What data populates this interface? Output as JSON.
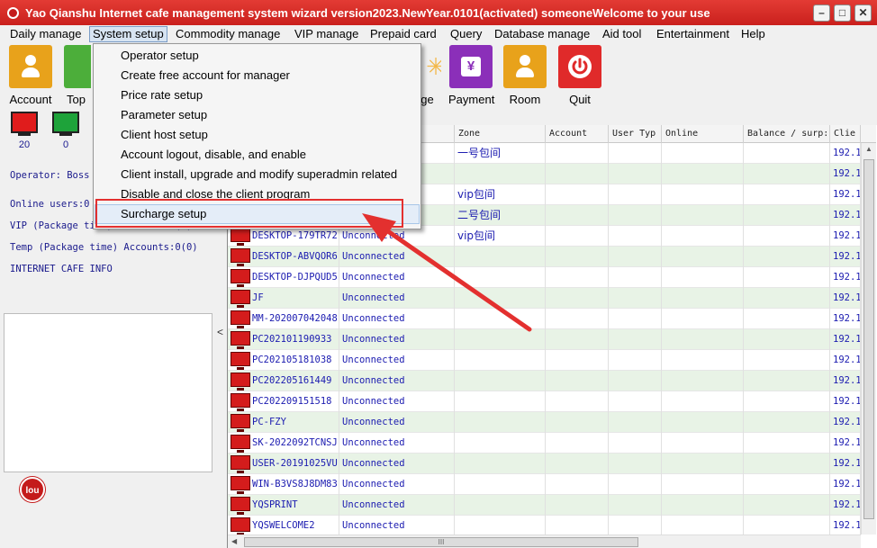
{
  "window": {
    "title": "Yao Qianshu Internet cafe management system wizard version2023.NewYear.0101(activated)   someoneWelcome to your use",
    "controls": {
      "minimize": "–",
      "maximize": "□",
      "close": "✕"
    }
  },
  "menu": [
    {
      "label": "Daily manage"
    },
    {
      "label": "System setup"
    },
    {
      "label": "Commodity manage"
    },
    {
      "label": "VIP manage"
    },
    {
      "label": "Prepaid card"
    },
    {
      "label": "Query"
    },
    {
      "label": "Database manage"
    },
    {
      "label": "Aid tool"
    },
    {
      "label": "Entertainment"
    },
    {
      "label": "Help"
    }
  ],
  "toolbar": {
    "account": {
      "label": "Account",
      "icon": "person-icon",
      "color": "#e8a21b"
    },
    "top": {
      "label": "Top",
      "icon": "topup-icon",
      "color": "#4cae3a"
    },
    "manage": {
      "label": "age",
      "icon": "manage-icon",
      "color": "#f3b84a"
    },
    "payment": {
      "label": "Payment",
      "icon": "yen-icon",
      "symbol": "¥",
      "color": "#8b2fb9"
    },
    "room": {
      "label": "Room",
      "icon": "person-icon",
      "color": "#e8a21b"
    },
    "quit": {
      "label": "Quit",
      "icon": "power-icon",
      "color": "#e02a2a"
    }
  },
  "left": {
    "stats": [
      {
        "value": "20",
        "color": "#e01c1c"
      },
      {
        "value": "0",
        "color": "#1ea33a"
      }
    ],
    "operator": "Operator: Boss",
    "online_users": "Online users:0",
    "vip": "VIP (Package time) Accounts:0(0)",
    "temp": "Temp (Package time) Accounts:0(0)",
    "info": "INTERNET CAFE  INFO",
    "logo": "lou",
    "splitter_arrow": "<"
  },
  "dropdown": {
    "items": [
      {
        "label": "Operator setup"
      },
      {
        "label": "Create free account for manager"
      },
      {
        "label": "Price rate setup"
      },
      {
        "label": "Parameter setup"
      },
      {
        "label": "Client host setup"
      },
      {
        "label": "Account logout, disable, and enable"
      },
      {
        "label": "Client install, upgrade and modify superadmin related"
      },
      {
        "label": "Disable and close the client program"
      },
      {
        "label": "Surcharge setup"
      }
    ]
  },
  "grid": {
    "headers": [
      "me)",
      "Zone",
      "Account",
      "User Typ",
      "Online",
      "Balance / surp:",
      "Clie"
    ],
    "rows": [
      {
        "name": "",
        "status": "",
        "zone": "一号包间",
        "ip": "192.1"
      },
      {
        "name": "",
        "status": "",
        "zone": "",
        "ip": "192.1"
      },
      {
        "name": "",
        "status": "",
        "zone": "vip包间",
        "ip": "192.1"
      },
      {
        "name": "",
        "status": "",
        "zone": "二号包间",
        "ip": "192.1"
      },
      {
        "name": "DESKTOP-179TR72",
        "status": "Unconnected",
        "zone": "vip包间",
        "ip": "192.1"
      },
      {
        "name": "DESKTOP-ABVQOR6",
        "status": "Unconnected",
        "zone": "",
        "ip": "192.1"
      },
      {
        "name": "DESKTOP-DJPQUD5",
        "status": "Unconnected",
        "zone": "",
        "ip": "192.1"
      },
      {
        "name": "JF",
        "status": "Unconnected",
        "zone": "",
        "ip": "192.1"
      },
      {
        "name": "MM-202007042048",
        "status": "Unconnected",
        "zone": "",
        "ip": "192.1"
      },
      {
        "name": "PC202101190933",
        "status": "Unconnected",
        "zone": "",
        "ip": "192.1"
      },
      {
        "name": "PC202105181038",
        "status": "Unconnected",
        "zone": "",
        "ip": "192.1"
      },
      {
        "name": "PC202205161449",
        "status": "Unconnected",
        "zone": "",
        "ip": "192.1"
      },
      {
        "name": "PC202209151518",
        "status": "Unconnected",
        "zone": "",
        "ip": "192.1"
      },
      {
        "name": "PC-FZY",
        "status": "Unconnected",
        "zone": "",
        "ip": "192.1"
      },
      {
        "name": "SK-2022092TCNSJ",
        "status": "Unconnected",
        "zone": "",
        "ip": "192.1"
      },
      {
        "name": "USER-20191025VU",
        "status": "Unconnected",
        "zone": "",
        "ip": "192.1"
      },
      {
        "name": "WIN-B3VS8J8DM83",
        "status": "Unconnected",
        "zone": "",
        "ip": "192.1"
      },
      {
        "name": "YQSPRINT",
        "status": "Unconnected",
        "zone": "",
        "ip": "192.1"
      },
      {
        "name": "YQSWELCOME2",
        "status": "Unconnected",
        "zone": "",
        "ip": "192.1"
      }
    ],
    "hscroll_grip": "III"
  },
  "colors": {
    "title_bar": "#d42a25",
    "annotation": "#e3302f",
    "row_alt": "#e8f3e6",
    "grid_text": "#1b1bb0"
  }
}
